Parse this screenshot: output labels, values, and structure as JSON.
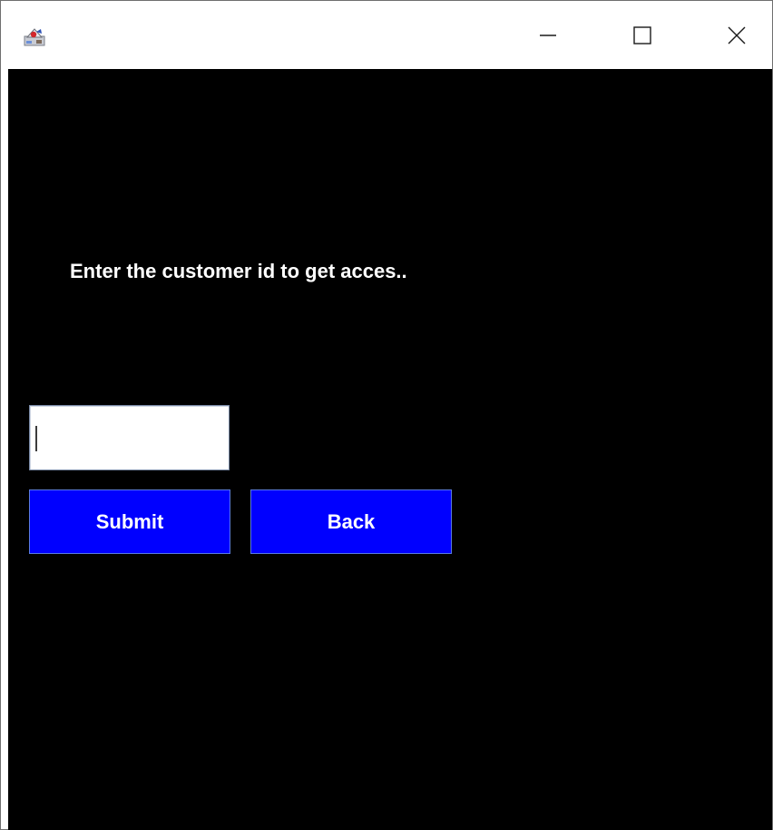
{
  "window": {
    "title": "",
    "icons": {
      "app": "java-app-icon",
      "minimize": "minimize-icon",
      "maximize": "maximize-icon",
      "close": "close-icon"
    }
  },
  "form": {
    "prompt_label": "Enter the customer id to get acces..",
    "customer_id_value": "",
    "submit_label": "Submit",
    "back_label": "Back"
  },
  "colors": {
    "background": "#000000",
    "button_bg": "#0000ff",
    "text": "#ffffff"
  }
}
